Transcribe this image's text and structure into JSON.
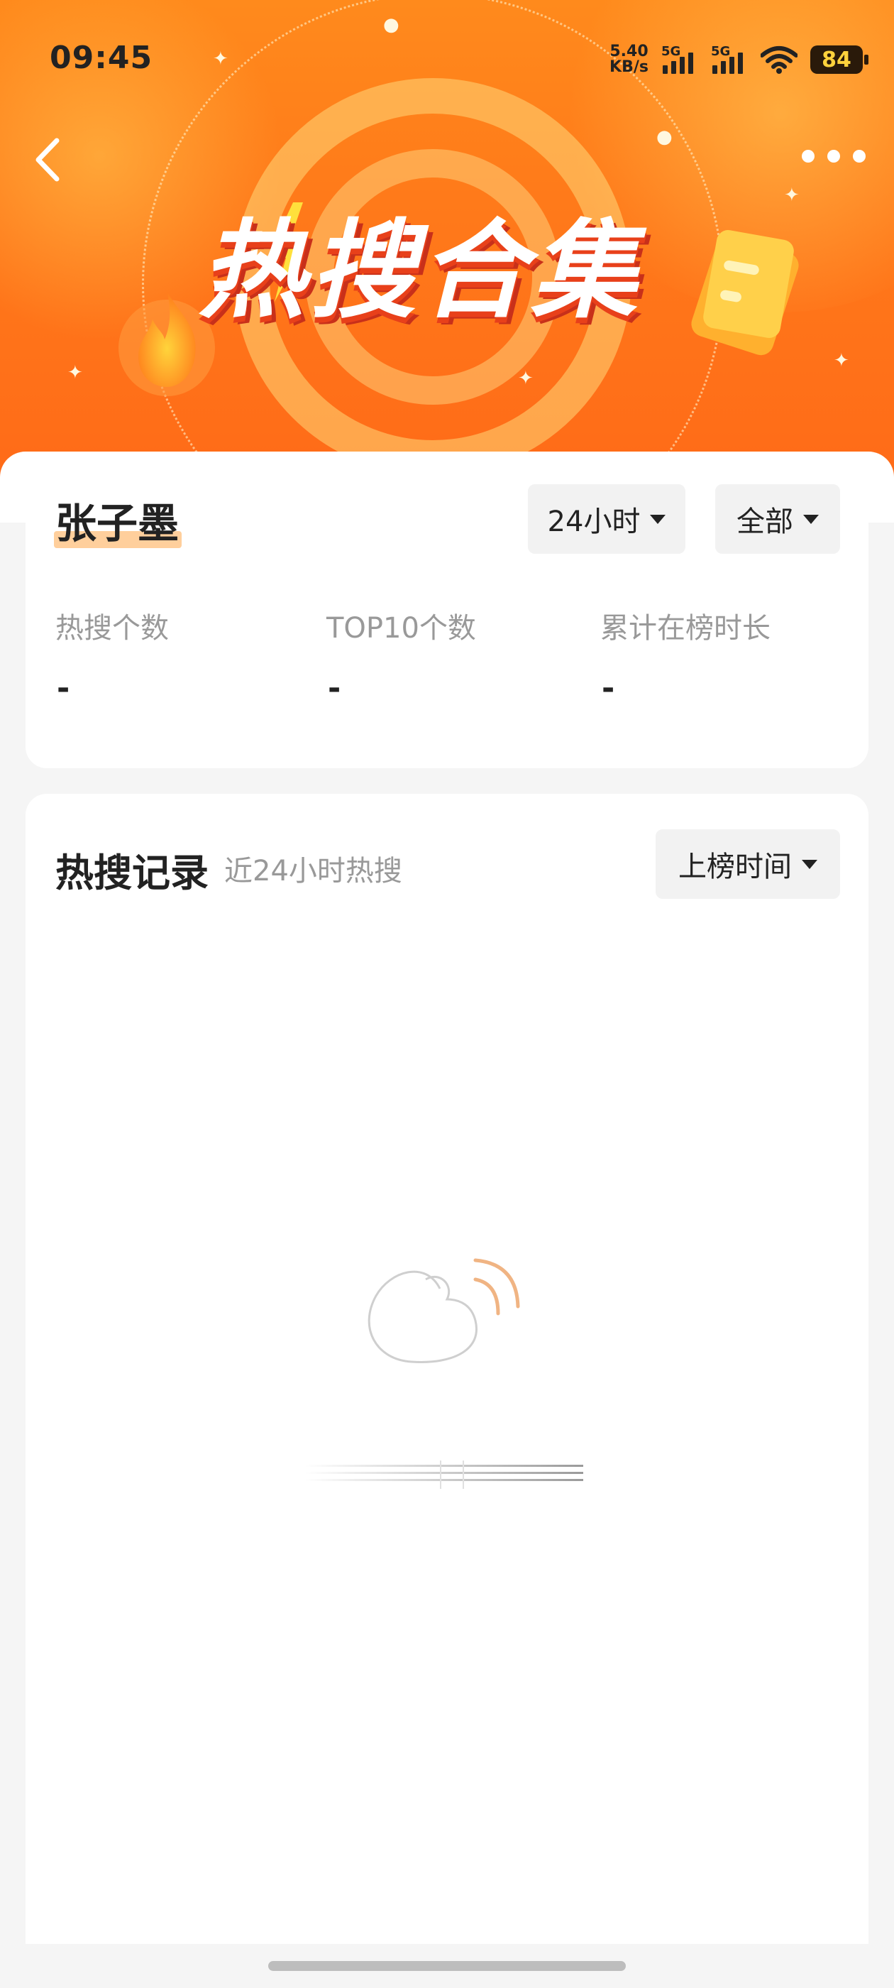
{
  "status_bar": {
    "time": "09:45",
    "net_speed_value": "5.40",
    "net_speed_unit": "KB/s",
    "sim1_label": "5G",
    "sim2_label": "5G",
    "battery": "84"
  },
  "header": {
    "banner_title": "热搜合集",
    "accent_color": "#ff7a1a"
  },
  "profile": {
    "name": "张子墨",
    "time_filter": "24小时",
    "scope_filter": "全部"
  },
  "stats": [
    {
      "label": "热搜个数",
      "value": "-"
    },
    {
      "label": "TOP10个数",
      "value": "-"
    },
    {
      "label": "累计在榜时长",
      "value": "-"
    }
  ],
  "records": {
    "title": "热搜记录",
    "subtitle": "近24小时热搜",
    "sort_label": "上榜时间"
  }
}
